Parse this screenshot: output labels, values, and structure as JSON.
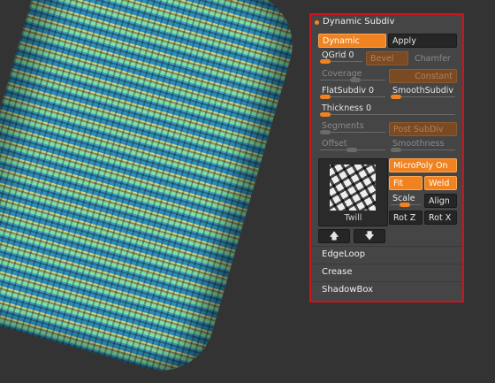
{
  "panel": {
    "title": "Dynamic Subdiv",
    "dynamic_label": "Dynamic",
    "apply_label": "Apply",
    "qgrid_label": "QGrid 0",
    "bevel_label": "Bevel",
    "chamfer_label": "Chamfer",
    "coverage_label": "Coverage",
    "constant_label": "Constant",
    "flatsubdiv_label": "FlatSubdiv 0",
    "smoothsubdiv_label": "SmoothSubdiv",
    "thickness_label": "Thickness 0",
    "segments_label": "Segments",
    "postsubdiv_label": "Post SubDiv",
    "offset_label": "Offset",
    "smoothness_label": "Smoothness",
    "micropoly_label": "MicroPoly On",
    "fit_label": "Fit",
    "weld_label": "Weld",
    "scale_label": "Scale",
    "align_label": "Align",
    "rotz_label": "Rot Z",
    "rotx_label": "Rot X",
    "thumb_label": "Twill",
    "arrow_up": "🡅",
    "arrow_down": "🡇",
    "sections": [
      "EdgeLoop",
      "Crease",
      "ShadowBox"
    ]
  },
  "colors": {
    "accent": "#f0821f",
    "border_highlight": "#d0121a",
    "panel_bg": "#454545",
    "viewport_bg": "#333333"
  }
}
